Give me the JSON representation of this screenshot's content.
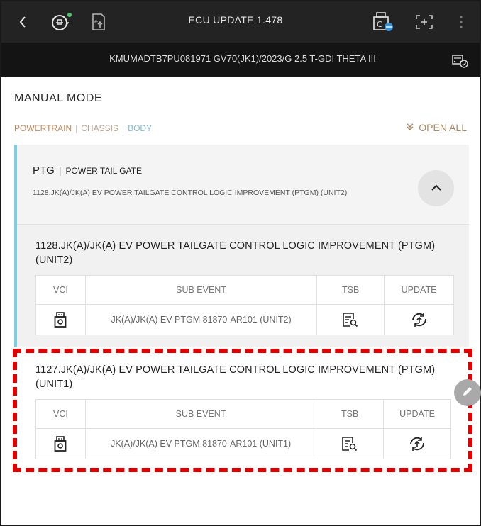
{
  "header": {
    "title": "ECU UPDATE 1.478",
    "icons": [
      "back-icon",
      "vehicle-scan-icon",
      "export-icon",
      "vci-connection-icon",
      "screen-capture-icon",
      "more-options-icon"
    ]
  },
  "vehicle": {
    "info": "KMUMADTB7PU081971  GV70(JK1)/2023/G 2.5 T-GDI THETA III",
    "icon": "vehicle-info-icon"
  },
  "mode_title": "MANUAL MODE",
  "tabs": [
    {
      "label": "POWERTRAIN",
      "color": "#c48a5c"
    },
    {
      "label": "CHASSIS",
      "color": "#b9a38e"
    },
    {
      "label": "BODY",
      "color": "#7fbcd1"
    }
  ],
  "tab_separator": "|",
  "open_all_label": "OPEN ALL",
  "group": {
    "code": "PTG",
    "separator": "|",
    "name": "POWER TAIL GATE",
    "description": "1128.JK(A)/JK(A) EV POWER TAILGATE CONTROL LOGIC IMPROVEMENT (PTGM) (UNIT2)",
    "accent_color": "#7ccde0"
  },
  "table_headers": [
    "VCI",
    "SUB EVENT",
    "TSB",
    "UPDATE"
  ],
  "events": [
    {
      "title": "1128.JK(A)/JK(A) EV POWER TAILGATE CONTROL LOGIC IMPROVEMENT (PTGM) (UNIT2)",
      "sub_event": "JK(A)/JK(A) EV PTGM 81870-AR101 (UNIT2)"
    },
    {
      "title": "1127.JK(A)/JK(A) EV POWER TAILGATE CONTROL LOGIC IMPROVEMENT (PTGM) (UNIT1)",
      "sub_event": "JK(A)/JK(A) EV PTGM 81870-AR101 (UNIT1)"
    }
  ],
  "highlight_color": "#e00000"
}
